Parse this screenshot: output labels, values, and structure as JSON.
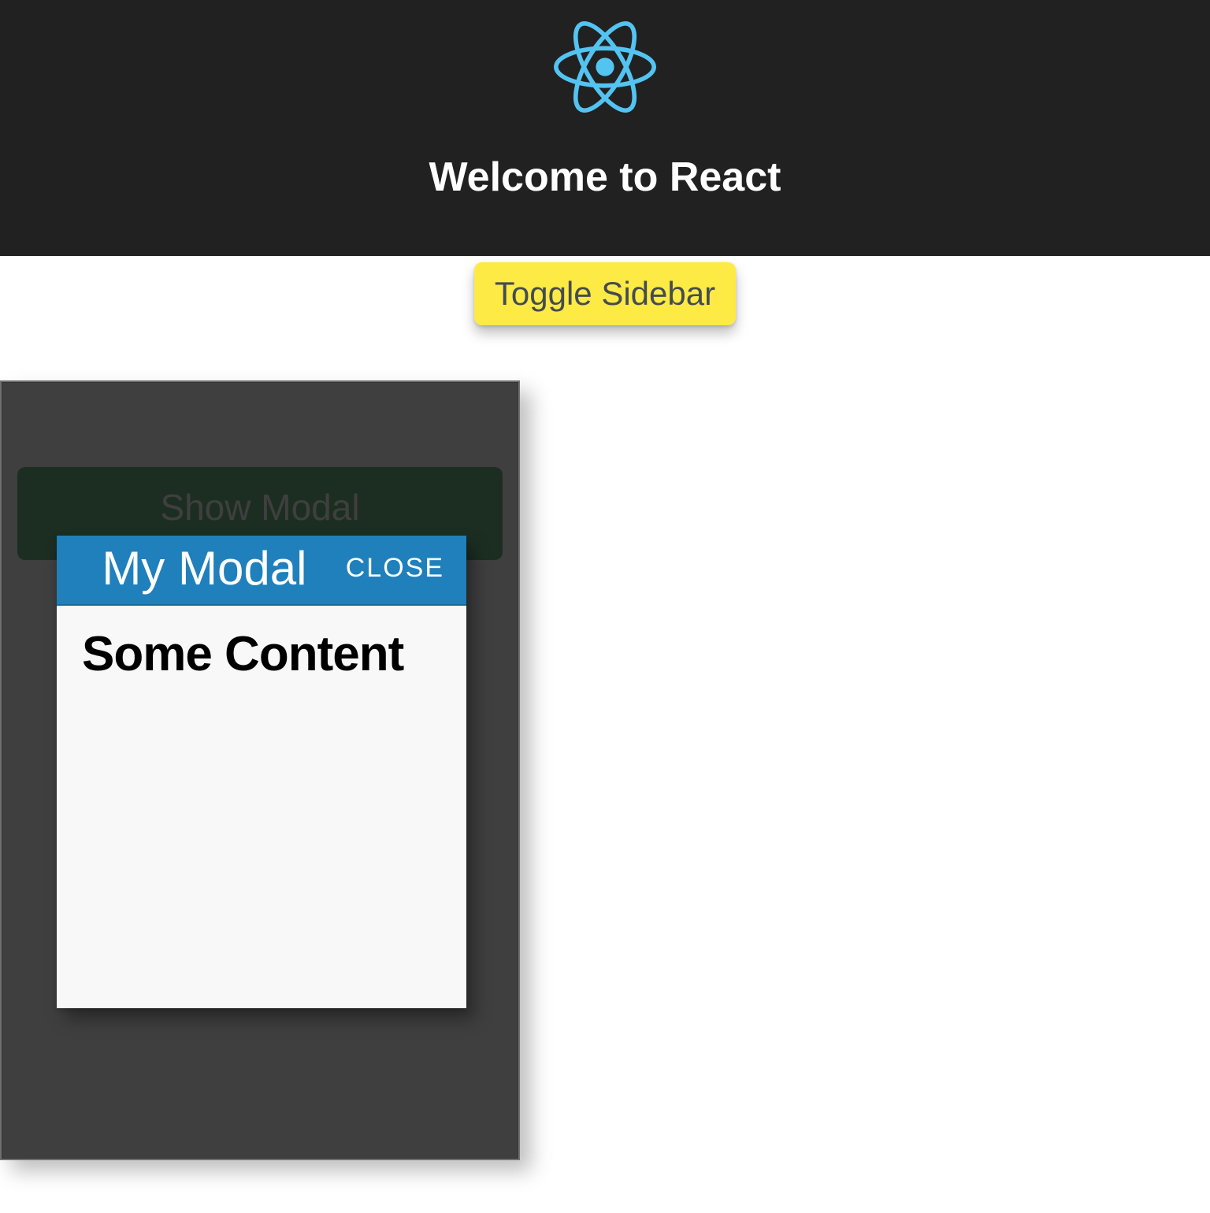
{
  "header": {
    "title": "Welcome to React"
  },
  "buttons": {
    "toggle_sidebar": "Toggle Sidebar",
    "show_modal": "Show Modal"
  },
  "modal": {
    "title": "My Modal",
    "close_label": "CLOSE",
    "content_heading": "Some Content"
  },
  "colors": {
    "header_bg": "#212121",
    "accent_yellow": "#fdea45",
    "sidebar_bg": "#3f3f3f",
    "modal_header": "#1f80bb",
    "logo_blue": "#53c4f2"
  }
}
